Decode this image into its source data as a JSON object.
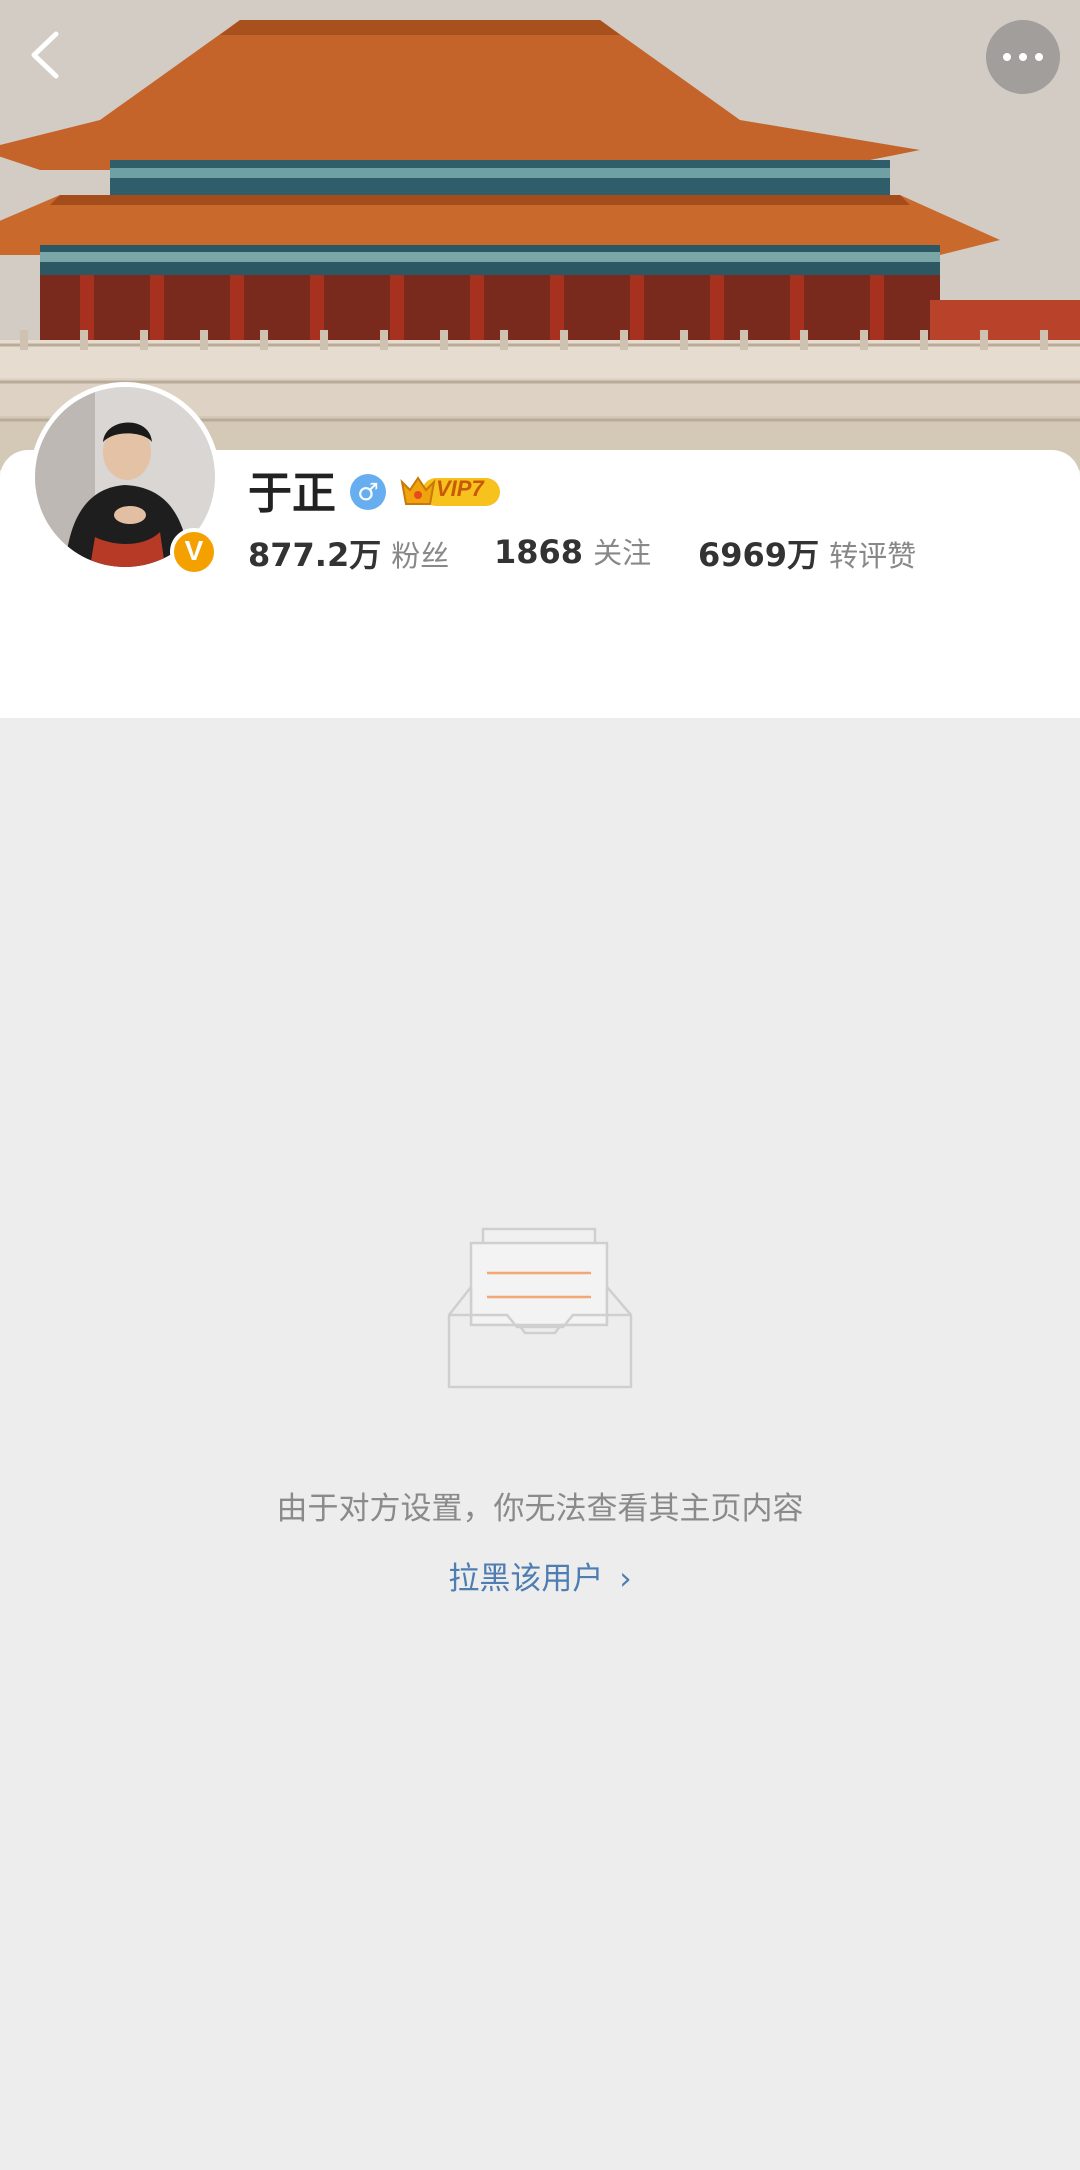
{
  "header": {
    "back_icon": "chevron-left-icon",
    "more_icon": "more-horizontal-icon"
  },
  "profile": {
    "name": "于正",
    "gender_icon": "male-icon",
    "gender_symbol": "♂",
    "vip_label": "VIP7",
    "verified_icon": "verified-v-icon",
    "verified_symbol": "V",
    "stats": [
      {
        "value": "877.2万",
        "label": "粉丝"
      },
      {
        "value": "1868",
        "label": "关注"
      },
      {
        "value": "6969万",
        "label": "转评赞"
      }
    ]
  },
  "empty_state": {
    "icon": "empty-inbox-icon",
    "message": "由于对方设置，你无法查看其主页内容",
    "action_label": "拉黑该用户",
    "action_icon": "chevron-right-icon",
    "action_symbol": "›"
  },
  "colors": {
    "link": "#4e7db1",
    "vip_gold": "#f4b400",
    "verified": "#f4a100",
    "gender": "#66aef0",
    "background": "#ededed"
  }
}
